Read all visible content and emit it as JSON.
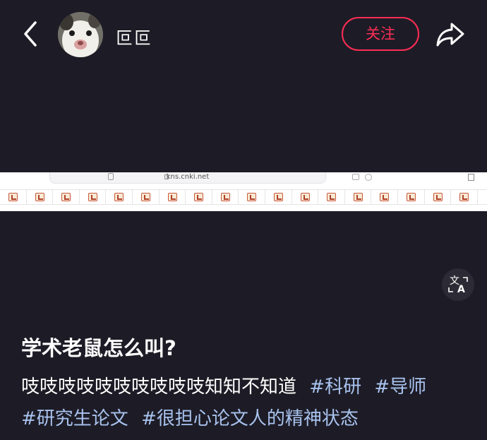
{
  "header": {
    "back_icon": "chevron-left-icon",
    "username": "叵叵",
    "follow_label": "关注",
    "share_icon": "share-arrow-icon"
  },
  "image": {
    "url": "kns.cnki.net",
    "tab_count": 18,
    "favicon": "cnki-favicon-icon"
  },
  "translate_icon": "translate-icon",
  "post": {
    "title": "学术老鼠怎么叫?",
    "text": "吱吱吱吱吱吱吱吱吱吱知知不知道",
    "tags": [
      "#科研",
      "#导师",
      "#研究生论文",
      "#很担心论文人的精神状态"
    ]
  },
  "colors": {
    "background": "#1d1c26",
    "follow_accent": "#ff2d55",
    "tag_color": "#a9c3ef"
  }
}
